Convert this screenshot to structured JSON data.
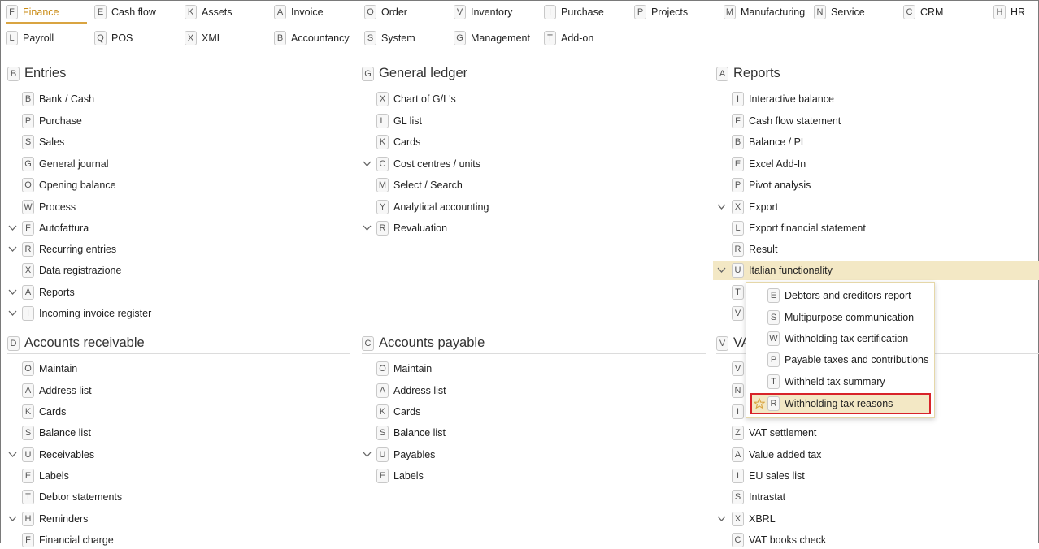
{
  "tabs_row1": [
    {
      "key": "F",
      "label": "Finance",
      "active": true
    },
    {
      "key": "E",
      "label": "Cash flow"
    },
    {
      "key": "K",
      "label": "Assets"
    },
    {
      "key": "A",
      "label": "Invoice"
    },
    {
      "key": "O",
      "label": "Order"
    },
    {
      "key": "V",
      "label": "Inventory"
    },
    {
      "key": "I",
      "label": "Purchase"
    },
    {
      "key": "P",
      "label": "Projects"
    },
    {
      "key": "M",
      "label": "Manufacturing"
    },
    {
      "key": "N",
      "label": "Service"
    },
    {
      "key": "C",
      "label": "CRM"
    },
    {
      "key": "H",
      "label": "HR"
    }
  ],
  "tabs_row2": [
    {
      "key": "L",
      "label": "Payroll"
    },
    {
      "key": "Q",
      "label": "POS"
    },
    {
      "key": "X",
      "label": "XML"
    },
    {
      "key": "B",
      "label": "Accountancy"
    },
    {
      "key": "S",
      "label": "System"
    },
    {
      "key": "G",
      "label": "Management"
    },
    {
      "key": "T",
      "label": "Add-on"
    }
  ],
  "entries": {
    "key": "B",
    "title": "Entries",
    "items": [
      {
        "key": "B",
        "label": "Bank / Cash"
      },
      {
        "key": "P",
        "label": "Purchase"
      },
      {
        "key": "S",
        "label": "Sales"
      },
      {
        "key": "G",
        "label": "General journal"
      },
      {
        "key": "O",
        "label": "Opening balance"
      },
      {
        "key": "W",
        "label": "Process"
      },
      {
        "key": "F",
        "label": "Autofattura",
        "expandable": true
      },
      {
        "key": "R",
        "label": "Recurring entries",
        "expandable": true
      },
      {
        "key": "X",
        "label": "Data registrazione"
      },
      {
        "key": "A",
        "label": "Reports",
        "expandable": true
      },
      {
        "key": "I",
        "label": "Incoming invoice register",
        "expandable": true
      }
    ]
  },
  "general_ledger": {
    "key": "G",
    "title": "General ledger",
    "items": [
      {
        "key": "X",
        "label": "Chart of G/L's"
      },
      {
        "key": "L",
        "label": "GL list"
      },
      {
        "key": "K",
        "label": "Cards"
      },
      {
        "key": "C",
        "label": "Cost centres / units",
        "expandable": true
      },
      {
        "key": "M",
        "label": "Select / Search"
      },
      {
        "key": "Y",
        "label": "Analytical accounting"
      },
      {
        "key": "R",
        "label": "Revaluation",
        "expandable": true
      }
    ]
  },
  "reports": {
    "key": "A",
    "title": "Reports",
    "items": [
      {
        "key": "I",
        "label": "Interactive balance"
      },
      {
        "key": "F",
        "label": "Cash flow statement"
      },
      {
        "key": "B",
        "label": "Balance / PL"
      },
      {
        "key": "E",
        "label": "Excel Add-In"
      },
      {
        "key": "P",
        "label": "Pivot analysis"
      },
      {
        "key": "X",
        "label": "Export",
        "expandable": true
      },
      {
        "key": "L",
        "label": "Export financial statement"
      },
      {
        "key": "R",
        "label": "Result"
      },
      {
        "key": "U",
        "label": "Italian functionality",
        "expandable": true,
        "highlighted": true
      },
      {
        "key": "T",
        "label": ""
      },
      {
        "key": "V",
        "label": ""
      }
    ]
  },
  "accounts_receivable": {
    "key": "D",
    "title": "Accounts receivable",
    "items": [
      {
        "key": "O",
        "label": "Maintain"
      },
      {
        "key": "A",
        "label": "Address list"
      },
      {
        "key": "K",
        "label": "Cards"
      },
      {
        "key": "S",
        "label": "Balance list"
      },
      {
        "key": "U",
        "label": "Receivables",
        "expandable": true
      },
      {
        "key": "E",
        "label": "Labels"
      },
      {
        "key": "T",
        "label": "Debtor statements"
      },
      {
        "key": "H",
        "label": "Reminders",
        "expandable": true
      },
      {
        "key": "F",
        "label": "Financial charge"
      }
    ]
  },
  "accounts_payable": {
    "key": "C",
    "title": "Accounts payable",
    "items": [
      {
        "key": "O",
        "label": "Maintain"
      },
      {
        "key": "A",
        "label": "Address list"
      },
      {
        "key": "K",
        "label": "Cards"
      },
      {
        "key": "S",
        "label": "Balance list"
      },
      {
        "key": "U",
        "label": "Payables",
        "expandable": true
      },
      {
        "key": "E",
        "label": "Labels"
      }
    ]
  },
  "vat": {
    "key": "V",
    "title": "VA",
    "items": [
      {
        "key": "V",
        "label": ""
      },
      {
        "key": "N",
        "label": ""
      },
      {
        "key": "I",
        "label": ""
      },
      {
        "key": "Z",
        "label": "VAT settlement"
      },
      {
        "key": "A",
        "label": "Value added tax"
      },
      {
        "key": "I",
        "label": "EU sales list"
      },
      {
        "key": "S",
        "label": "Intrastat"
      },
      {
        "key": "X",
        "label": "XBRL",
        "expandable": true
      },
      {
        "key": "C",
        "label": "VAT books check"
      }
    ]
  },
  "popup": {
    "items": [
      {
        "key": "E",
        "label": "Debtors and creditors report"
      },
      {
        "key": "S",
        "label": "Multipurpose communication"
      },
      {
        "key": "W",
        "label": "Withholding tax certification"
      },
      {
        "key": "P",
        "label": "Payable taxes and contributions"
      },
      {
        "key": "T",
        "label": "Withheld tax summary"
      },
      {
        "key": "R",
        "label": "Withholding tax reasons",
        "selected": true
      }
    ]
  },
  "colors": {
    "accent": "#d9a441",
    "highlight": "#f3e8c5",
    "selection_border": "#d8232a"
  }
}
